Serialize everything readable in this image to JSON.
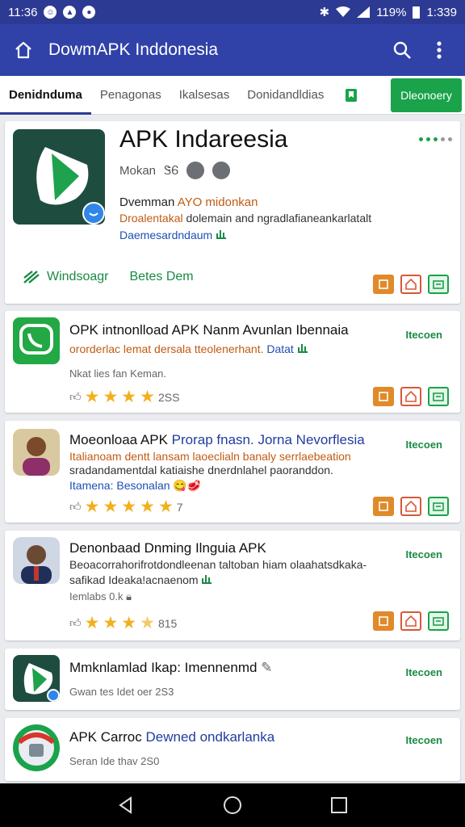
{
  "status_bar": {
    "left_time": "11:36",
    "right_battery": "119%",
    "right_time": "1:339"
  },
  "app_bar": {
    "title": "DowmAPK Inddonesia"
  },
  "tabs": {
    "items": [
      "Denidnduma",
      "Penagonas",
      "Ikalsesas",
      "Donidandldias"
    ],
    "cta": "Dleonoery"
  },
  "featured": {
    "title": "APK Indareesia",
    "meta_text": "Mokan",
    "meta_mark": "ᏕᏮ",
    "line1_a": "Dvemman ",
    "line1_b": "AYO midonkan",
    "line2_a": "Droalentakal ",
    "line2_b": "dolemain and ngradlafianeankarlatalt",
    "line3": "Daemesardndaum",
    "action_primary": "Windsoagr",
    "action_secondary": "Betes Dem"
  },
  "apps": [
    {
      "title": "OPK intnonlload APK Nanm Avunlan Ibennaia",
      "sub_org": "ororderlac lemat dersala tteolenerhant.",
      "sub_blu": "Datat",
      "gray": "Nkat lies fan Keman.",
      "rating_count": "2SS",
      "tag": "Itecoen"
    },
    {
      "title_a": "Moeonloaa APK ",
      "title_b": "Prorap fnasn. Jorna Nevorflesia",
      "sub1": "Italianoam dentt lansam laoeclialn banaly serrlaebeation",
      "sub2": "sradandamentdal katiaishe dnerdnlahel paoranddon.",
      "sub3": "Itamena: Besonalan",
      "rating_count": "7",
      "tag": "Itecoen"
    },
    {
      "title": "Denonbaad Dnming Ilnguia APK",
      "sub1": "Beoacorrahorifrotdondleenan taltoban hiam olaahatsdkaka-",
      "sub2": "safikad Ideaka!acnaenom",
      "gray": "Iemlabs 0.k",
      "rating_count": "815",
      "tag": "Itecoen"
    },
    {
      "title": "Mmknlamlad Ikap: Imennenmd",
      "gray": "Gwan tes Idet oer 2S3",
      "tag": "Itecoen"
    },
    {
      "title_a": "APK Carroc ",
      "title_b": "Dewned ondkarlanka",
      "gray": "Seran Ide thav 2S0",
      "tag": "Itecoen"
    }
  ],
  "colors": {
    "status_bar": "#2d3a94",
    "app_bar": "#3042a8",
    "accent_green": "#1aa34a",
    "accent_orange": "#c25b12"
  }
}
